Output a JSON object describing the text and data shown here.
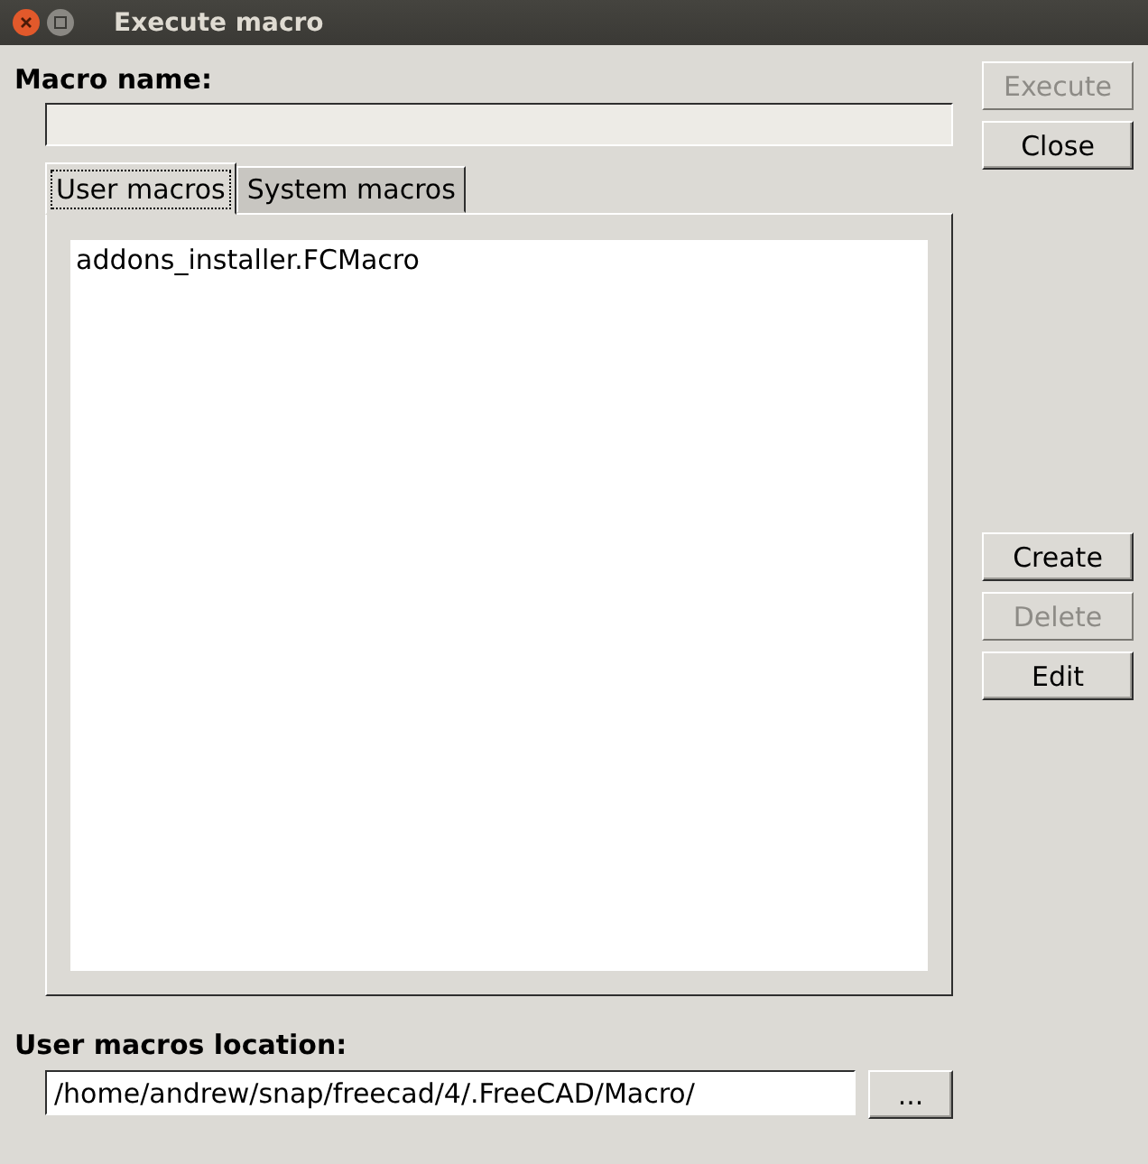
{
  "window": {
    "title": "Execute macro"
  },
  "macro_name": {
    "label": "Macro name:"
  },
  "tabs": [
    {
      "label": "User macros",
      "selected": true
    },
    {
      "label": "System macros",
      "selected": false
    }
  ],
  "macros": [
    {
      "name": "addons_installer.FCMacro",
      "selected": false
    }
  ],
  "top_buttons": [
    {
      "label": "Execute",
      "disabled": true
    },
    {
      "label": "Close",
      "disabled": false
    }
  ],
  "macro_buttons": [
    {
      "label": "Create",
      "disabled": false
    },
    {
      "label": "Delete",
      "disabled": true
    },
    {
      "label": "Edit",
      "disabled": false
    }
  ],
  "location": {
    "label": "User macros location:",
    "value": "/home/andrew/snap/freecad/4/.FreeCAD/Macro/",
    "browse_button": "..."
  }
}
